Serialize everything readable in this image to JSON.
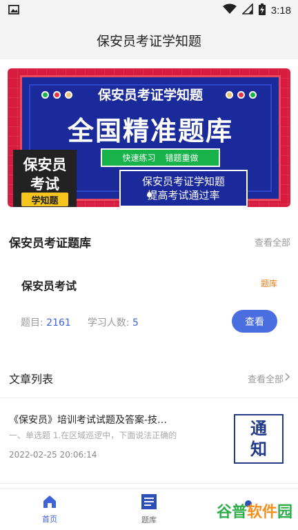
{
  "status_bar": {
    "time": "3:18",
    "icons": [
      "image-icon",
      "wifi-icon",
      "signal-icon",
      "battery-charging-icon"
    ]
  },
  "app_bar": {
    "title": "保安员考证学知题"
  },
  "banner": {
    "top_title": "保安员考证学知题",
    "main_title": "全国精准题库",
    "chip_1": "快速练习",
    "chip_2": "错题重做",
    "subtitle_line1": "保安员考证学知题",
    "subtitle_line2": "提高考试通过率",
    "badge_line1": "保安员",
    "badge_line2": "考试",
    "badge_line3": "学知题",
    "colors": {
      "background": "#d81c3f",
      "panel": "#1b2a9a",
      "green": "#17b34a",
      "yellow": "#f5c51b"
    }
  },
  "bank_section": {
    "title": "保安员考证题库",
    "view_all": "查看全部",
    "card": {
      "name": "保安员考试",
      "tag": "题库",
      "question_label": "题目:",
      "question_count": "2161",
      "learners_label": "学习人数:",
      "learners_count": "5",
      "button": "查看"
    }
  },
  "article_section": {
    "title": "文章列表",
    "view_all": "查看全部",
    "items": [
      {
        "title": "《保安员》培训考试试题及答案-技…",
        "summary": "一、单选题 1.在区域巡逻中，下面说法正确的",
        "date": "2022-02-25 20:06:14",
        "thumb_line1": "通",
        "thumb_line2": "知"
      }
    ]
  },
  "bottom_nav": {
    "items": [
      {
        "label": "首页",
        "icon": "home-icon",
        "active": true
      },
      {
        "label": "题库",
        "icon": "question-bank-icon",
        "active": false
      },
      {
        "label": "",
        "icon": "profile-icon",
        "active": false
      }
    ],
    "accent": "#3e62d8"
  },
  "watermark": {
    "part1": "谷普",
    "part2": "软件",
    "part3": "园"
  }
}
